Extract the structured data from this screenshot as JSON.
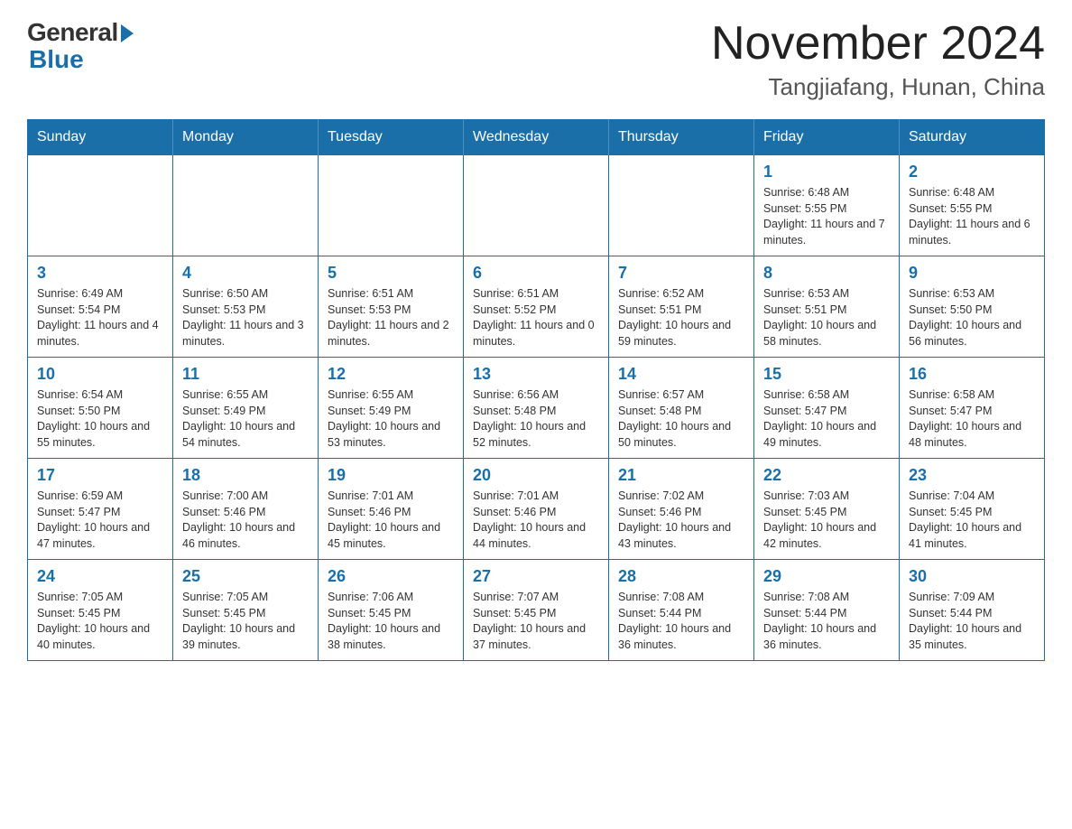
{
  "header": {
    "logo_general": "General",
    "logo_blue": "Blue",
    "month_year": "November 2024",
    "location": "Tangjiafang, Hunan, China"
  },
  "weekdays": [
    "Sunday",
    "Monday",
    "Tuesday",
    "Wednesday",
    "Thursday",
    "Friday",
    "Saturday"
  ],
  "weeks": [
    [
      {
        "day": "",
        "info": ""
      },
      {
        "day": "",
        "info": ""
      },
      {
        "day": "",
        "info": ""
      },
      {
        "day": "",
        "info": ""
      },
      {
        "day": "",
        "info": ""
      },
      {
        "day": "1",
        "info": "Sunrise: 6:48 AM\nSunset: 5:55 PM\nDaylight: 11 hours and 7 minutes."
      },
      {
        "day": "2",
        "info": "Sunrise: 6:48 AM\nSunset: 5:55 PM\nDaylight: 11 hours and 6 minutes."
      }
    ],
    [
      {
        "day": "3",
        "info": "Sunrise: 6:49 AM\nSunset: 5:54 PM\nDaylight: 11 hours and 4 minutes."
      },
      {
        "day": "4",
        "info": "Sunrise: 6:50 AM\nSunset: 5:53 PM\nDaylight: 11 hours and 3 minutes."
      },
      {
        "day": "5",
        "info": "Sunrise: 6:51 AM\nSunset: 5:53 PM\nDaylight: 11 hours and 2 minutes."
      },
      {
        "day": "6",
        "info": "Sunrise: 6:51 AM\nSunset: 5:52 PM\nDaylight: 11 hours and 0 minutes."
      },
      {
        "day": "7",
        "info": "Sunrise: 6:52 AM\nSunset: 5:51 PM\nDaylight: 10 hours and 59 minutes."
      },
      {
        "day": "8",
        "info": "Sunrise: 6:53 AM\nSunset: 5:51 PM\nDaylight: 10 hours and 58 minutes."
      },
      {
        "day": "9",
        "info": "Sunrise: 6:53 AM\nSunset: 5:50 PM\nDaylight: 10 hours and 56 minutes."
      }
    ],
    [
      {
        "day": "10",
        "info": "Sunrise: 6:54 AM\nSunset: 5:50 PM\nDaylight: 10 hours and 55 minutes."
      },
      {
        "day": "11",
        "info": "Sunrise: 6:55 AM\nSunset: 5:49 PM\nDaylight: 10 hours and 54 minutes."
      },
      {
        "day": "12",
        "info": "Sunrise: 6:55 AM\nSunset: 5:49 PM\nDaylight: 10 hours and 53 minutes."
      },
      {
        "day": "13",
        "info": "Sunrise: 6:56 AM\nSunset: 5:48 PM\nDaylight: 10 hours and 52 minutes."
      },
      {
        "day": "14",
        "info": "Sunrise: 6:57 AM\nSunset: 5:48 PM\nDaylight: 10 hours and 50 minutes."
      },
      {
        "day": "15",
        "info": "Sunrise: 6:58 AM\nSunset: 5:47 PM\nDaylight: 10 hours and 49 minutes."
      },
      {
        "day": "16",
        "info": "Sunrise: 6:58 AM\nSunset: 5:47 PM\nDaylight: 10 hours and 48 minutes."
      }
    ],
    [
      {
        "day": "17",
        "info": "Sunrise: 6:59 AM\nSunset: 5:47 PM\nDaylight: 10 hours and 47 minutes."
      },
      {
        "day": "18",
        "info": "Sunrise: 7:00 AM\nSunset: 5:46 PM\nDaylight: 10 hours and 46 minutes."
      },
      {
        "day": "19",
        "info": "Sunrise: 7:01 AM\nSunset: 5:46 PM\nDaylight: 10 hours and 45 minutes."
      },
      {
        "day": "20",
        "info": "Sunrise: 7:01 AM\nSunset: 5:46 PM\nDaylight: 10 hours and 44 minutes."
      },
      {
        "day": "21",
        "info": "Sunrise: 7:02 AM\nSunset: 5:46 PM\nDaylight: 10 hours and 43 minutes."
      },
      {
        "day": "22",
        "info": "Sunrise: 7:03 AM\nSunset: 5:45 PM\nDaylight: 10 hours and 42 minutes."
      },
      {
        "day": "23",
        "info": "Sunrise: 7:04 AM\nSunset: 5:45 PM\nDaylight: 10 hours and 41 minutes."
      }
    ],
    [
      {
        "day": "24",
        "info": "Sunrise: 7:05 AM\nSunset: 5:45 PM\nDaylight: 10 hours and 40 minutes."
      },
      {
        "day": "25",
        "info": "Sunrise: 7:05 AM\nSunset: 5:45 PM\nDaylight: 10 hours and 39 minutes."
      },
      {
        "day": "26",
        "info": "Sunrise: 7:06 AM\nSunset: 5:45 PM\nDaylight: 10 hours and 38 minutes."
      },
      {
        "day": "27",
        "info": "Sunrise: 7:07 AM\nSunset: 5:45 PM\nDaylight: 10 hours and 37 minutes."
      },
      {
        "day": "28",
        "info": "Sunrise: 7:08 AM\nSunset: 5:44 PM\nDaylight: 10 hours and 36 minutes."
      },
      {
        "day": "29",
        "info": "Sunrise: 7:08 AM\nSunset: 5:44 PM\nDaylight: 10 hours and 36 minutes."
      },
      {
        "day": "30",
        "info": "Sunrise: 7:09 AM\nSunset: 5:44 PM\nDaylight: 10 hours and 35 minutes."
      }
    ]
  ]
}
